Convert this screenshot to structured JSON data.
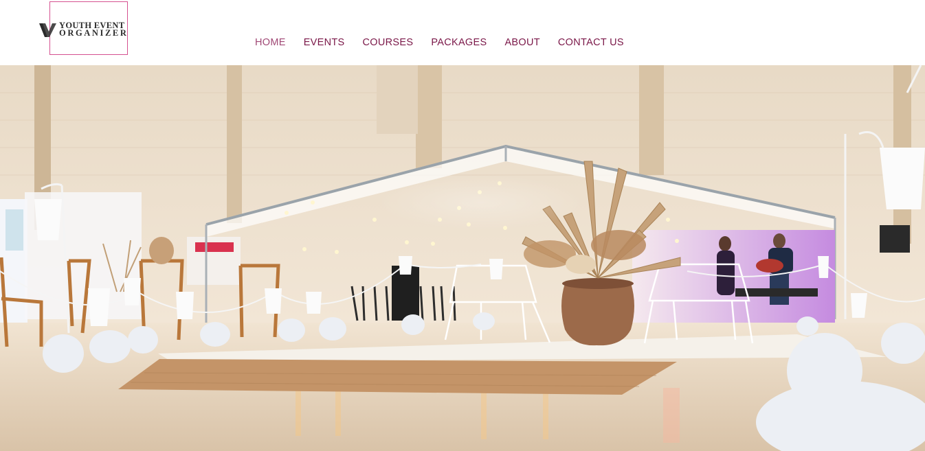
{
  "brand": {
    "line1": "YOUTH EVENT",
    "line2": "ORGANIZER",
    "frame_color": "#d4508f",
    "icon": "logo-mark-icon"
  },
  "nav": {
    "items": [
      {
        "label": "HOME",
        "active": true
      },
      {
        "label": "EVENTS",
        "active": false
      },
      {
        "label": "COURSES",
        "active": false
      },
      {
        "label": "PACKAGES",
        "active": false
      },
      {
        "label": "ABOUT",
        "active": false
      },
      {
        "label": "CONTACT US",
        "active": false
      }
    ],
    "color": "#7a1748"
  },
  "hero": {
    "image": "event-venue-hero-photo",
    "palette": {
      "wall": "#efe2d0",
      "floor": "#e9d9c6",
      "rug": "#c79a6b",
      "accent_purple": "#c78be0"
    }
  }
}
